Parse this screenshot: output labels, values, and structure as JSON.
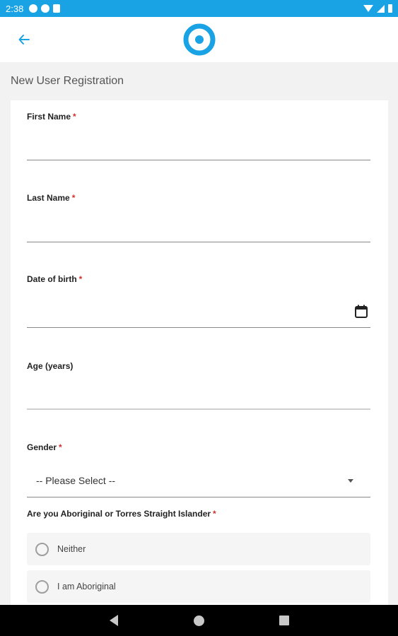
{
  "status_bar": {
    "time": "2:38",
    "icons": [
      "a-icon",
      "p-icon",
      "sd-card-icon"
    ],
    "right_icons": [
      "wifi-icon",
      "signal-icon",
      "battery-icon"
    ]
  },
  "header": {
    "back_icon": "arrow-left-icon",
    "logo_icon": "target-logo-icon",
    "accent_color": "#1aa3e4"
  },
  "page": {
    "title": "New User Registration"
  },
  "form": {
    "required_mark": "*",
    "first_name": {
      "label": "First Name",
      "value": ""
    },
    "last_name": {
      "label": "Last Name",
      "value": ""
    },
    "dob": {
      "label": "Date of birth",
      "value": "",
      "icon": "calendar-icon"
    },
    "age": {
      "label": "Age (years)",
      "value": ""
    },
    "gender": {
      "label": "Gender",
      "selected": "-- Please Select --"
    },
    "aboriginal": {
      "label": "Are you Aboriginal or Torres Straight Islander",
      "options": [
        "Neither",
        "I am Aboriginal"
      ]
    }
  },
  "nav": {
    "icons": [
      "nav-back-icon",
      "nav-home-icon",
      "nav-recents-icon"
    ]
  }
}
